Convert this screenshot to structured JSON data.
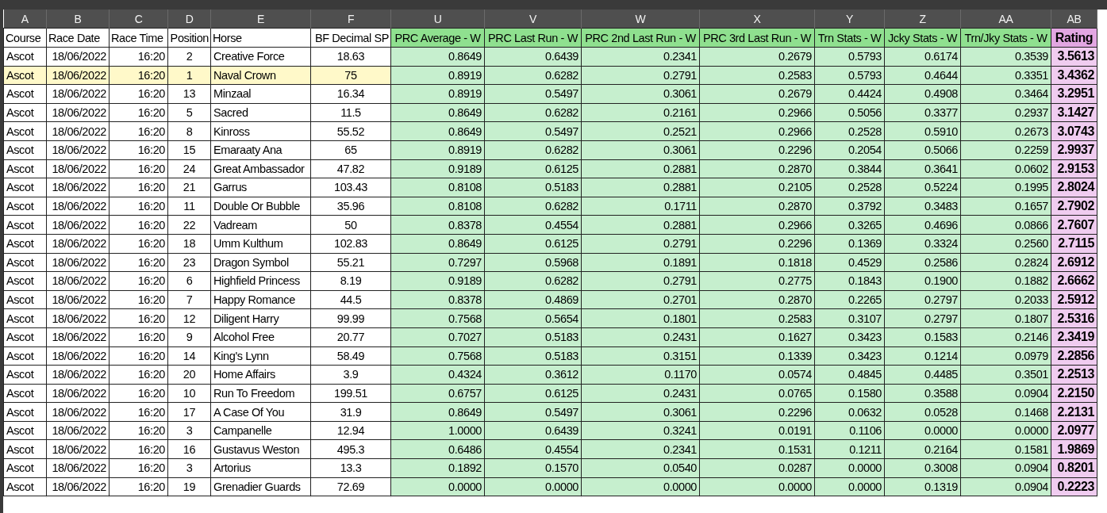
{
  "columns": [
    {
      "letter": "A",
      "title": "Course",
      "kind": "label"
    },
    {
      "letter": "B",
      "title": "Race Date",
      "kind": "value"
    },
    {
      "letter": "C",
      "title": "Race Time",
      "kind": "value"
    },
    {
      "letter": "D",
      "title": "Position",
      "kind": "centered"
    },
    {
      "letter": "E",
      "title": "Horse",
      "kind": "label"
    },
    {
      "letter": "F",
      "title": "BF Decimal SP",
      "kind": "centered"
    },
    {
      "letter": "U",
      "title": "PRC Average - W",
      "kind": "weight"
    },
    {
      "letter": "V",
      "title": "PRC Last Run - W",
      "kind": "weight"
    },
    {
      "letter": "W",
      "title": "PRC 2nd Last Run - W",
      "kind": "weight"
    },
    {
      "letter": "X",
      "title": "PRC 3rd Last Run - W",
      "kind": "weight"
    },
    {
      "letter": "Y",
      "title": "Trn Stats - W",
      "kind": "weight"
    },
    {
      "letter": "Z",
      "title": "Jcky Stats - W",
      "kind": "weight"
    },
    {
      "letter": "AA",
      "title": "Trn/Jky Stats - W",
      "kind": "weight"
    },
    {
      "letter": "AB",
      "title": "Rating",
      "kind": "rating"
    }
  ],
  "rows": [
    {
      "highlighted": false,
      "cells": [
        "Ascot",
        "18/06/2022",
        "16:20",
        "2",
        "Creative Force",
        "18.63",
        "0.8649",
        "0.6439",
        "0.2341",
        "0.2679",
        "0.5793",
        "0.6174",
        "0.3539",
        "3.5613"
      ]
    },
    {
      "highlighted": true,
      "cells": [
        "Ascot",
        "18/06/2022",
        "16:20",
        "1",
        "Naval Crown",
        "75",
        "0.8919",
        "0.6282",
        "0.2791",
        "0.2583",
        "0.5793",
        "0.4644",
        "0.3351",
        "3.4362"
      ]
    },
    {
      "highlighted": false,
      "cells": [
        "Ascot",
        "18/06/2022",
        "16:20",
        "13",
        "Minzaal",
        "16.34",
        "0.8919",
        "0.5497",
        "0.3061",
        "0.2679",
        "0.4424",
        "0.4908",
        "0.3464",
        "3.2951"
      ]
    },
    {
      "highlighted": false,
      "cells": [
        "Ascot",
        "18/06/2022",
        "16:20",
        "5",
        "Sacred",
        "11.5",
        "0.8649",
        "0.6282",
        "0.2161",
        "0.2966",
        "0.5056",
        "0.3377",
        "0.2937",
        "3.1427"
      ]
    },
    {
      "highlighted": false,
      "cells": [
        "Ascot",
        "18/06/2022",
        "16:20",
        "8",
        "Kinross",
        "55.52",
        "0.8649",
        "0.5497",
        "0.2521",
        "0.2966",
        "0.2528",
        "0.5910",
        "0.2673",
        "3.0743"
      ]
    },
    {
      "highlighted": false,
      "cells": [
        "Ascot",
        "18/06/2022",
        "16:20",
        "15",
        "Emaraaty Ana",
        "65",
        "0.8919",
        "0.6282",
        "0.3061",
        "0.2296",
        "0.2054",
        "0.5066",
        "0.2259",
        "2.9937"
      ]
    },
    {
      "highlighted": false,
      "cells": [
        "Ascot",
        "18/06/2022",
        "16:20",
        "24",
        "Great Ambassador",
        "47.82",
        "0.9189",
        "0.6125",
        "0.2881",
        "0.2870",
        "0.3844",
        "0.3641",
        "0.0602",
        "2.9153"
      ]
    },
    {
      "highlighted": false,
      "cells": [
        "Ascot",
        "18/06/2022",
        "16:20",
        "21",
        "Garrus",
        "103.43",
        "0.8108",
        "0.5183",
        "0.2881",
        "0.2105",
        "0.2528",
        "0.5224",
        "0.1995",
        "2.8024"
      ]
    },
    {
      "highlighted": false,
      "cells": [
        "Ascot",
        "18/06/2022",
        "16:20",
        "11",
        "Double Or Bubble",
        "35.96",
        "0.8108",
        "0.6282",
        "0.1711",
        "0.2870",
        "0.3792",
        "0.3483",
        "0.1657",
        "2.7902"
      ]
    },
    {
      "highlighted": false,
      "cells": [
        "Ascot",
        "18/06/2022",
        "16:20",
        "22",
        "Vadream",
        "50",
        "0.8378",
        "0.4554",
        "0.2881",
        "0.2966",
        "0.3265",
        "0.4696",
        "0.0866",
        "2.7607"
      ]
    },
    {
      "highlighted": false,
      "cells": [
        "Ascot",
        "18/06/2022",
        "16:20",
        "18",
        "Umm Kulthum",
        "102.83",
        "0.8649",
        "0.6125",
        "0.2791",
        "0.2296",
        "0.1369",
        "0.3324",
        "0.2560",
        "2.7115"
      ]
    },
    {
      "highlighted": false,
      "cells": [
        "Ascot",
        "18/06/2022",
        "16:20",
        "23",
        "Dragon Symbol",
        "55.21",
        "0.7297",
        "0.5968",
        "0.1891",
        "0.1818",
        "0.4529",
        "0.2586",
        "0.2824",
        "2.6912"
      ]
    },
    {
      "highlighted": false,
      "cells": [
        "Ascot",
        "18/06/2022",
        "16:20",
        "6",
        "Highfield Princess",
        "8.19",
        "0.9189",
        "0.6282",
        "0.2791",
        "0.2775",
        "0.1843",
        "0.1900",
        "0.1882",
        "2.6662"
      ]
    },
    {
      "highlighted": false,
      "cells": [
        "Ascot",
        "18/06/2022",
        "16:20",
        "7",
        "Happy Romance",
        "44.5",
        "0.8378",
        "0.4869",
        "0.2701",
        "0.2870",
        "0.2265",
        "0.2797",
        "0.2033",
        "2.5912"
      ]
    },
    {
      "highlighted": false,
      "cells": [
        "Ascot",
        "18/06/2022",
        "16:20",
        "12",
        "Diligent Harry",
        "99.99",
        "0.7568",
        "0.5654",
        "0.1801",
        "0.2583",
        "0.3107",
        "0.2797",
        "0.1807",
        "2.5316"
      ]
    },
    {
      "highlighted": false,
      "cells": [
        "Ascot",
        "18/06/2022",
        "16:20",
        "9",
        "Alcohol Free",
        "20.77",
        "0.7027",
        "0.5183",
        "0.2431",
        "0.1627",
        "0.3423",
        "0.1583",
        "0.2146",
        "2.3419"
      ]
    },
    {
      "highlighted": false,
      "cells": [
        "Ascot",
        "18/06/2022",
        "16:20",
        "14",
        "King's Lynn",
        "58.49",
        "0.7568",
        "0.5183",
        "0.3151",
        "0.1339",
        "0.3423",
        "0.1214",
        "0.0979",
        "2.2856"
      ]
    },
    {
      "highlighted": false,
      "cells": [
        "Ascot",
        "18/06/2022",
        "16:20",
        "20",
        "Home Affairs",
        "3.9",
        "0.4324",
        "0.3612",
        "0.1170",
        "0.0574",
        "0.4845",
        "0.4485",
        "0.3501",
        "2.2513"
      ]
    },
    {
      "highlighted": false,
      "cells": [
        "Ascot",
        "18/06/2022",
        "16:20",
        "10",
        "Run To Freedom",
        "199.51",
        "0.6757",
        "0.6125",
        "0.2431",
        "0.0765",
        "0.1580",
        "0.3588",
        "0.0904",
        "2.2150"
      ]
    },
    {
      "highlighted": false,
      "cells": [
        "Ascot",
        "18/06/2022",
        "16:20",
        "17",
        "A Case Of You",
        "31.9",
        "0.8649",
        "0.5497",
        "0.3061",
        "0.2296",
        "0.0632",
        "0.0528",
        "0.1468",
        "2.2131"
      ]
    },
    {
      "highlighted": false,
      "cells": [
        "Ascot",
        "18/06/2022",
        "16:20",
        "3",
        "Campanelle",
        "12.94",
        "1.0000",
        "0.6439",
        "0.3241",
        "0.0191",
        "0.1106",
        "0.0000",
        "0.0000",
        "2.0977"
      ]
    },
    {
      "highlighted": false,
      "cells": [
        "Ascot",
        "18/06/2022",
        "16:20",
        "16",
        "Gustavus Weston",
        "495.3",
        "0.6486",
        "0.4554",
        "0.2341",
        "0.1531",
        "0.1211",
        "0.2164",
        "0.1581",
        "1.9869"
      ]
    },
    {
      "highlighted": false,
      "cells": [
        "Ascot",
        "18/06/2022",
        "16:20",
        "3",
        "Artorius",
        "13.3",
        "0.1892",
        "0.1570",
        "0.0540",
        "0.0287",
        "0.0000",
        "0.3008",
        "0.0904",
        "0.8201"
      ]
    },
    {
      "highlighted": false,
      "cells": [
        "Ascot",
        "18/06/2022",
        "16:20",
        "19",
        "Grenadier Guards",
        "72.69",
        "0.0000",
        "0.0000",
        "0.0000",
        "0.0000",
        "0.0000",
        "0.1319",
        "0.0904",
        "0.2223"
      ]
    }
  ]
}
